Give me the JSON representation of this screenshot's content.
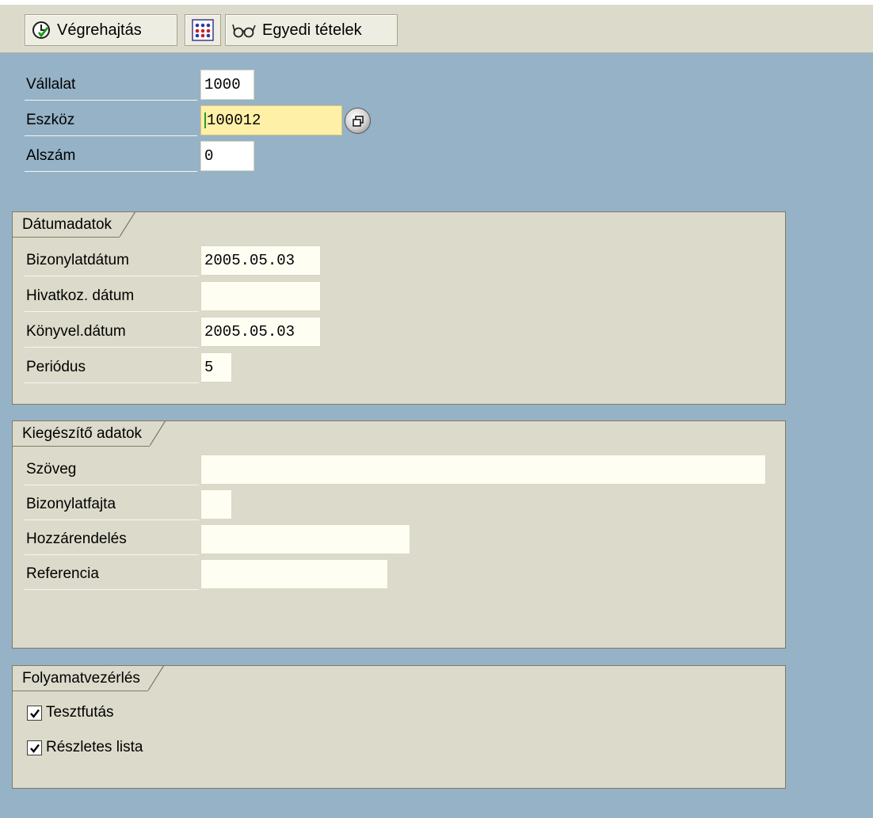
{
  "toolbar": {
    "execute_label": "Végrehajtás",
    "individual_items_label": "Egyedi tételek"
  },
  "header_fields": {
    "company_label": "Vállalat",
    "company_value": "1000",
    "asset_label": "Eszköz",
    "asset_value": "100012",
    "subnumber_label": "Alszám",
    "subnumber_value": "0"
  },
  "date_group": {
    "title": "Dátumadatok",
    "document_date_label": "Bizonylatdátum",
    "document_date_value": "2005.05.03",
    "reference_date_label": "Hivatkoz. dátum",
    "reference_date_value": "",
    "posting_date_label": "Könyvel.dátum",
    "posting_date_value": "2005.05.03",
    "period_label": "Periódus",
    "period_value": "5"
  },
  "additional_group": {
    "title": "Kiegészítő adatok",
    "text_label": "Szöveg",
    "text_value": "",
    "doc_type_label": "Bizonylatfajta",
    "doc_type_value": "",
    "assignment_label": "Hozzárendelés",
    "assignment_value": "",
    "reference_label": "Referencia",
    "reference_value": ""
  },
  "process_group": {
    "title": "Folyamatvezérlés",
    "test_run_label": "Tesztfutás",
    "test_run_checked": true,
    "detailed_list_label": "Részletes lista",
    "detailed_list_checked": true
  },
  "icons": {
    "execute": "execute-clock-icon",
    "options": "multi-dots-icon",
    "individual_items": "glasses-icon",
    "match_help": "possible-entries-icon",
    "checkbox": "check-icon"
  }
}
